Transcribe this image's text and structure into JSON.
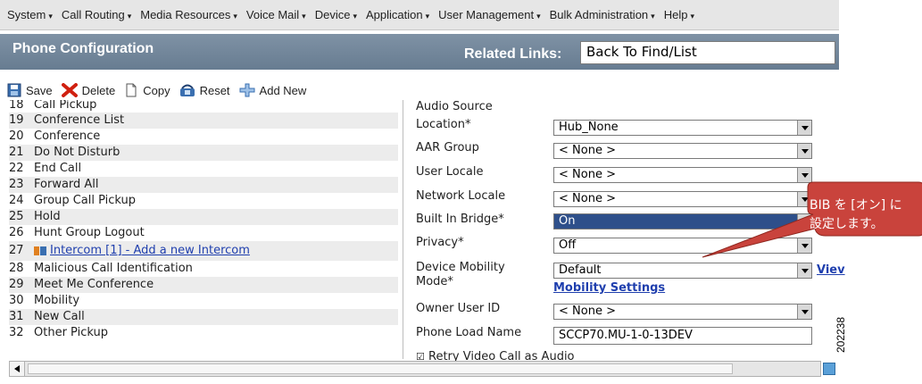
{
  "menubar": {
    "items": [
      {
        "label": "System"
      },
      {
        "label": "Call Routing"
      },
      {
        "label": "Media Resources"
      },
      {
        "label": "Voice Mail"
      },
      {
        "label": "Device"
      },
      {
        "label": "Application"
      },
      {
        "label": "User Management"
      },
      {
        "label": "Bulk Administration"
      },
      {
        "label": "Help"
      }
    ]
  },
  "header": {
    "title": "Phone Configuration",
    "related_label": "Related Links:",
    "related_value": "Back To Find/List"
  },
  "toolbar": {
    "save": "Save",
    "delete": "Delete",
    "copy": "Copy",
    "reset": "Reset",
    "add_new": "Add New"
  },
  "left_list": {
    "rows": [
      {
        "num": "18",
        "label": "Call Pickup"
      },
      {
        "num": "19",
        "label": "Conference List"
      },
      {
        "num": "20",
        "label": "Conference"
      },
      {
        "num": "21",
        "label": "Do Not Disturb"
      },
      {
        "num": "22",
        "label": "End Call"
      },
      {
        "num": "23",
        "label": "Forward All"
      },
      {
        "num": "24",
        "label": "Group Call Pickup"
      },
      {
        "num": "25",
        "label": "Hold"
      },
      {
        "num": "26",
        "label": "Hunt Group Logout"
      },
      {
        "num": "27",
        "label": "Intercom [1] - Add a new Intercom"
      },
      {
        "num": "28",
        "label": "Malicious Call Identification"
      },
      {
        "num": "29",
        "label": "Meet Me Conference"
      },
      {
        "num": "30",
        "label": "Mobility"
      },
      {
        "num": "31",
        "label": "New Call"
      },
      {
        "num": "32",
        "label": "Other Pickup"
      }
    ]
  },
  "form": {
    "audio_source": "Audio Source",
    "location": {
      "label": "Location*",
      "value": "Hub_None"
    },
    "aar_group": {
      "label": "AAR Group",
      "value": "< None >"
    },
    "user_locale": {
      "label": "User Locale",
      "value": "< None >"
    },
    "network_locale": {
      "label": "Network Locale",
      "value": "< None >"
    },
    "built_in_bridge": {
      "label": "Built In Bridge*",
      "value": "On"
    },
    "privacy": {
      "label": "Privacy*",
      "value": "Off"
    },
    "device_mobility": {
      "label_line1": "Device Mobility",
      "label_line2": "Mode*",
      "value": "Default",
      "view_link": "Viev",
      "mobility_settings": "Mobility Settings"
    },
    "owner_user_id": {
      "label": "Owner User ID",
      "value": "< None >"
    },
    "phone_load_name": {
      "label": "Phone Load Name",
      "value": "SCCP70.MU-1-0-13DEV"
    },
    "retry_video": {
      "label": "Retry Video Call as Audio",
      "checked": true
    }
  },
  "callout": {
    "line1": "BIB を [オン] に",
    "line2": "設定します。"
  },
  "figure_number": "202238"
}
